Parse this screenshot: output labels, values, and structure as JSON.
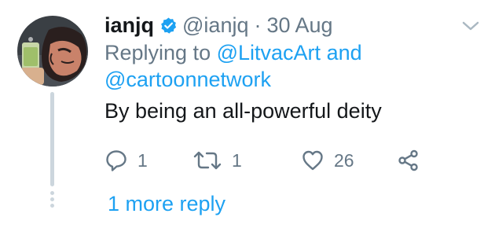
{
  "tweet": {
    "display_name": "ianjq",
    "handle": "@ianjq",
    "separator": "·",
    "date": "30 Aug",
    "replying_prefix": "Replying to",
    "replying_to_1": "@LitvacArt",
    "replying_and": "and",
    "replying_to_2": "@cartoonnetwork",
    "text": "By being an all-powerful deity",
    "reply_count": "1",
    "retweet_count": "1",
    "like_count": "26",
    "more_replies_label": "1 more reply"
  },
  "icons": {
    "verified": "verified-badge-icon",
    "menu": "chevron-down-icon",
    "reply": "reply-icon",
    "retweet": "retweet-icon",
    "like": "heart-icon",
    "share": "share-icon"
  },
  "colors": {
    "accent": "#1da1f2",
    "muted": "#657786",
    "text": "#14171a",
    "thread_line": "#ccd6dd"
  }
}
